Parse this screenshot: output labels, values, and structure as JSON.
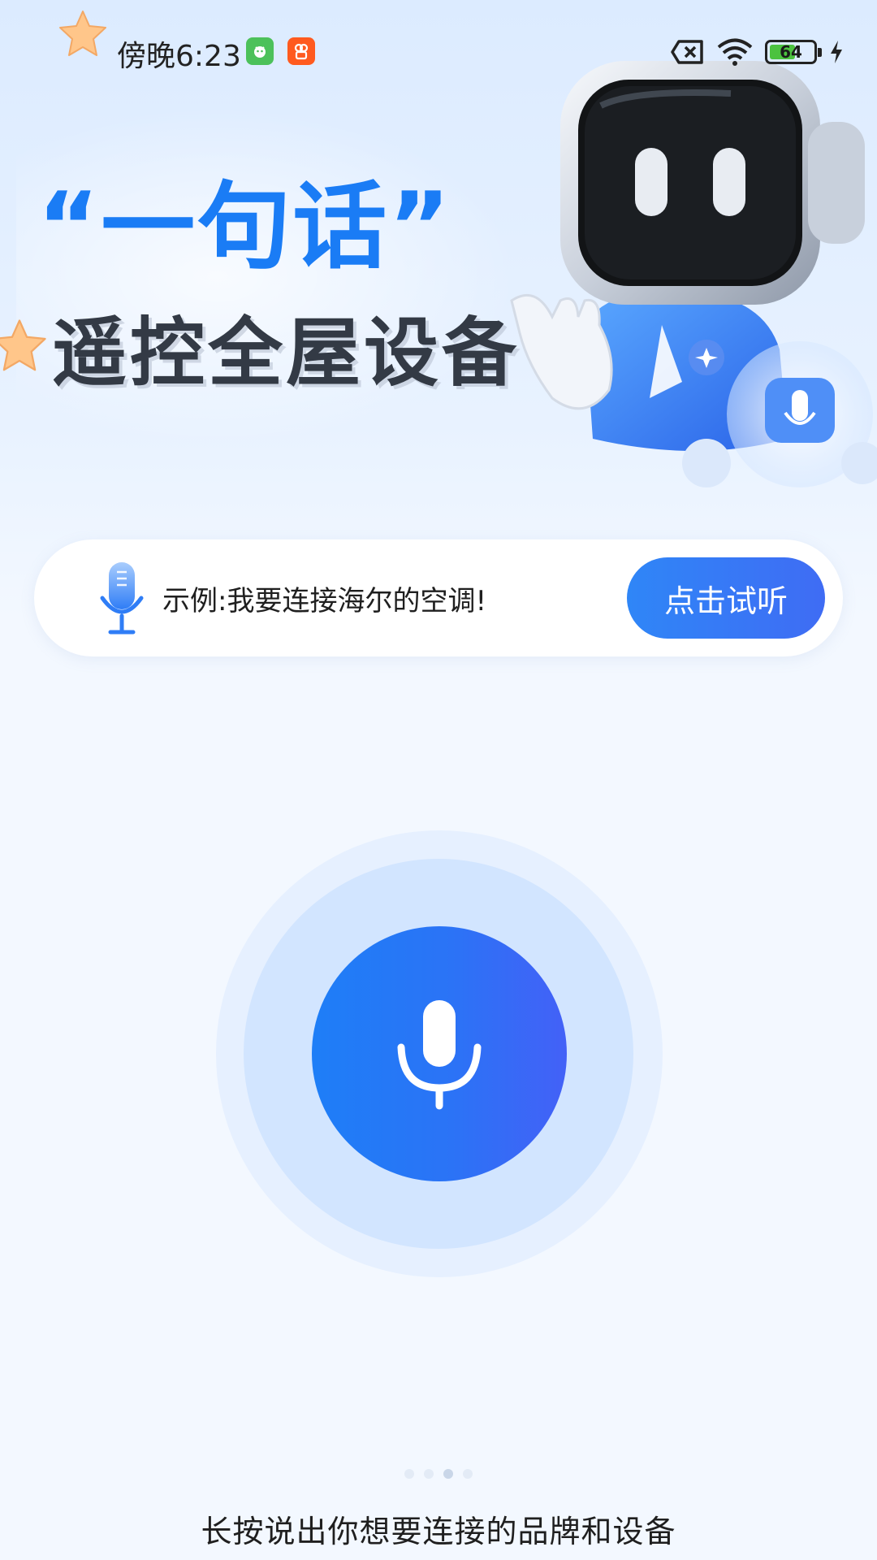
{
  "status_bar": {
    "time": "傍晚6:23",
    "battery": "64",
    "battery_level": 0.64,
    "icons": [
      "star-decoration",
      "app-green-icon",
      "app-orange-icon",
      "sim-off-icon",
      "wifi-icon",
      "battery-icon",
      "charging-icon"
    ]
  },
  "hero": {
    "title_main": "“一句话”",
    "title_sub": "遥控全屋设备",
    "illustration": "robot-mascot"
  },
  "example": {
    "text": "示例:我要连接海尔的空调!",
    "button_label": "点击试听",
    "icon": "microphone-icon"
  },
  "voice": {
    "icon": "microphone-icon",
    "hint": "长按说出你想要连接的品牌和设备"
  },
  "pager": {
    "count": 4,
    "active_index": 2
  },
  "colors": {
    "primary": "#1a7cf5",
    "button_gradient_start": "#2f86f7",
    "button_gradient_end": "#3f6cf4",
    "mic_gradient_end": "#4361f7",
    "title_dark": "#333a45"
  }
}
